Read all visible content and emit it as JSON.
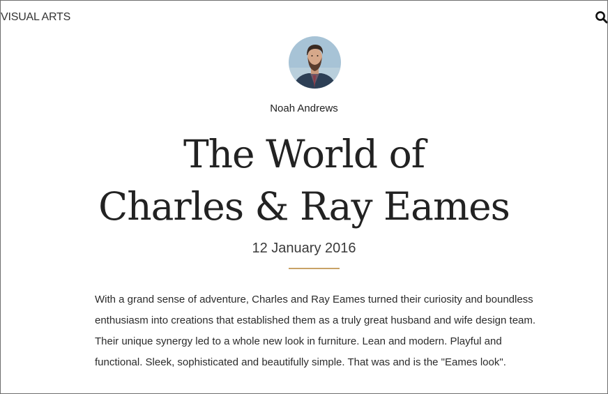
{
  "header": {
    "section": "VISUAL ARTS",
    "search_icon": "search-icon"
  },
  "article": {
    "author": "Noah Andrews",
    "avatar_icon": "author-avatar",
    "title_line1": "The World of",
    "title_line2": "Charles & Ray Eames",
    "date": "12 January 2016",
    "body": "With a grand sense of adventure, Charles and Ray Eames turned their curiosity and boundless enthusiasm into creations that established them as a truly great husband and wife design team. Their unique synergy led to a whole new look in furniture. Lean and modern. Playful and functional. Sleek, sophisticated and beautifully simple. That was and is the \"Eames look\"."
  },
  "colors": {
    "accent": "#c8a267",
    "text": "#222222",
    "background": "#ffffff"
  }
}
